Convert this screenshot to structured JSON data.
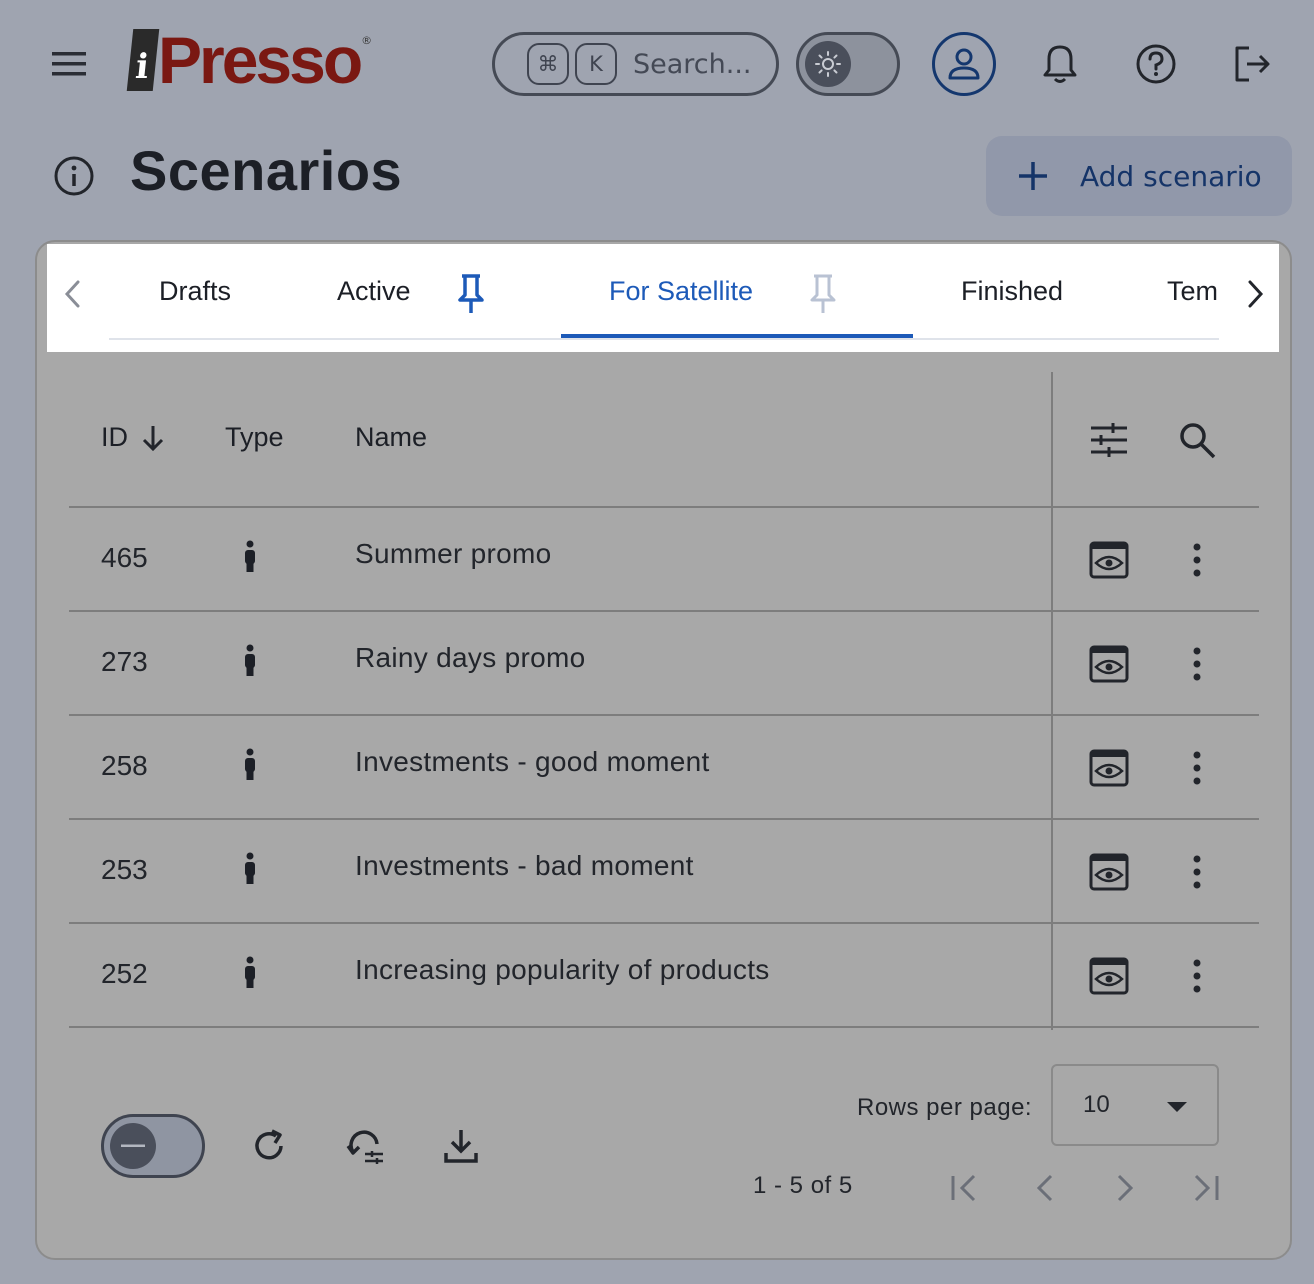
{
  "header": {
    "logo_letter": "i",
    "logo_text": "Presso",
    "logo_mark": "®",
    "search": {
      "key1": "⌘",
      "key2": "K",
      "placeholder": "Search..."
    },
    "icons": {
      "menu": "menu-icon",
      "theme": "sun-icon",
      "account": "account-icon",
      "notifications": "bell-icon",
      "help": "help-icon",
      "logout": "logout-icon"
    }
  },
  "page": {
    "title": "Scenarios",
    "add_label": "Add scenario"
  },
  "tabs": {
    "items": [
      {
        "label": "Drafts",
        "pinned": false,
        "selected": false
      },
      {
        "label": "Active",
        "pinned": true,
        "selected": false
      },
      {
        "label": "For Satellite",
        "pinned": true,
        "selected": true
      },
      {
        "label": "Finished",
        "pinned": false,
        "selected": false
      },
      {
        "label": "Tem",
        "pinned": false,
        "selected": false
      }
    ]
  },
  "table": {
    "columns": {
      "id": "ID",
      "type": "Type",
      "name": "Name"
    },
    "sort": {
      "column": "ID",
      "direction": "desc"
    },
    "rows": [
      {
        "id": "465",
        "name": "Summer promo"
      },
      {
        "id": "273",
        "name": "Rainy days promo"
      },
      {
        "id": "258",
        "name": "Investments - good moment"
      },
      {
        "id": "253",
        "name": "Investments - bad moment"
      },
      {
        "id": "252",
        "name": "Increasing popularity of products"
      }
    ]
  },
  "footer": {
    "rows_per_page_label": "Rows per page:",
    "rows_per_page_value": "10",
    "range": "1 - 5 of 5"
  },
  "colors": {
    "accent": "#1d5ab8",
    "brand": "#7a1812",
    "background": "#9fa4b0"
  }
}
